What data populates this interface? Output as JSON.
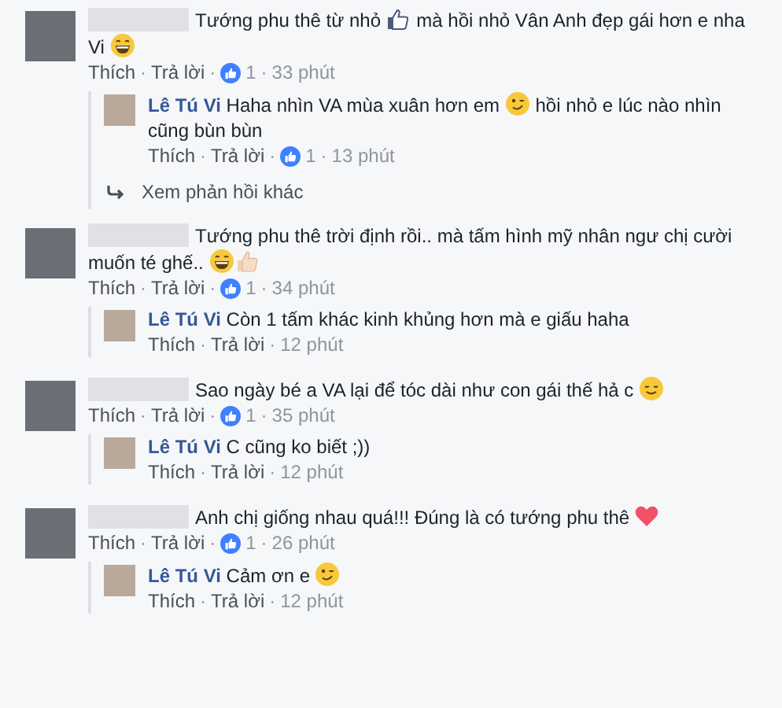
{
  "comments": [
    {
      "text": [
        {
          "kind": "text",
          "value": "Tướng phu thê từ nhỏ "
        },
        {
          "kind": "like-outline"
        },
        {
          "kind": "text",
          "value": " mà hồi nhỏ Vân Anh đẹp gái hơn e nha Vi "
        },
        {
          "kind": "laugh"
        }
      ],
      "meta": [
        {
          "kind": "link",
          "text": "Thích"
        },
        {
          "kind": "dot",
          "text": "·"
        },
        {
          "kind": "link",
          "text": "Trả lời"
        },
        {
          "kind": "dot",
          "text": "·"
        },
        {
          "kind": "likes",
          "text": "1"
        },
        {
          "kind": "dot",
          "text": "·"
        },
        {
          "kind": "time",
          "text": "33 phút"
        }
      ],
      "replies": [
        {
          "author": "Lê Tú Vi",
          "text": [
            {
              "kind": "text",
              "value": "Haha nhìn VA mùa xuân hơn em "
            },
            {
              "kind": "wink"
            },
            {
              "kind": "text",
              "value": " hồi nhỏ e lúc nào nhìn cũng bùn bùn"
            }
          ],
          "meta": [
            {
              "kind": "link",
              "text": "Thích"
            },
            {
              "kind": "dot",
              "text": "·"
            },
            {
              "kind": "link",
              "text": "Trả lời"
            },
            {
              "kind": "dot",
              "text": "·"
            },
            {
              "kind": "likes",
              "text": "1"
            },
            {
              "kind": "dot",
              "text": "·"
            },
            {
              "kind": "time",
              "text": "13 phút"
            }
          ]
        }
      ],
      "more_replies": "Xem phản hồi khác"
    },
    {
      "text": [
        {
          "kind": "text",
          "value": "Tướng phu thê trời định rồi.. mà tấm hình mỹ nhân ngư chị cười muốn té ghế.. "
        },
        {
          "kind": "laugh"
        },
        {
          "kind": "thumb"
        }
      ],
      "meta": [
        {
          "kind": "link",
          "text": "Thích"
        },
        {
          "kind": "dot",
          "text": "·"
        },
        {
          "kind": "link",
          "text": "Trả lời"
        },
        {
          "kind": "dot",
          "text": "·"
        },
        {
          "kind": "likes",
          "text": "1"
        },
        {
          "kind": "dot",
          "text": "·"
        },
        {
          "kind": "time",
          "text": "34 phút"
        }
      ],
      "replies": [
        {
          "author": "Lê Tú Vi",
          "text": [
            {
              "kind": "text",
              "value": "Còn 1 tấm khác kinh khủng hơn mà e giấu haha"
            }
          ],
          "meta": [
            {
              "kind": "link",
              "text": "Thích"
            },
            {
              "kind": "dot",
              "text": "·"
            },
            {
              "kind": "link",
              "text": "Trả lời"
            },
            {
              "kind": "dot",
              "text": "·"
            },
            {
              "kind": "time",
              "text": "12 phút"
            }
          ]
        }
      ]
    },
    {
      "text": [
        {
          "kind": "text",
          "value": "Sao ngày bé a VA lại để tóc dài như con gái thế hả c "
        },
        {
          "kind": "smile"
        }
      ],
      "meta": [
        {
          "kind": "link",
          "text": "Thích"
        },
        {
          "kind": "dot",
          "text": "·"
        },
        {
          "kind": "link",
          "text": "Trả lời"
        },
        {
          "kind": "dot",
          "text": "·"
        },
        {
          "kind": "likes",
          "text": "1"
        },
        {
          "kind": "dot",
          "text": "·"
        },
        {
          "kind": "time",
          "text": "35 phút"
        }
      ],
      "replies": [
        {
          "author": "Lê Tú Vi",
          "text": [
            {
              "kind": "text",
              "value": "C cũng ko biết ;))"
            }
          ],
          "meta": [
            {
              "kind": "link",
              "text": "Thích"
            },
            {
              "kind": "dot",
              "text": "·"
            },
            {
              "kind": "link",
              "text": "Trả lời"
            },
            {
              "kind": "dot",
              "text": "·"
            },
            {
              "kind": "time",
              "text": "12 phút"
            }
          ]
        }
      ]
    },
    {
      "text": [
        {
          "kind": "text",
          "value": "Anh chị giống nhau quá!!! Đúng là có tướng phu thê "
        },
        {
          "kind": "heart"
        }
      ],
      "meta": [
        {
          "kind": "link",
          "text": "Thích"
        },
        {
          "kind": "dot",
          "text": "·"
        },
        {
          "kind": "link",
          "text": "Trả lời"
        },
        {
          "kind": "dot",
          "text": "·"
        },
        {
          "kind": "likes",
          "text": "1"
        },
        {
          "kind": "dot",
          "text": "·"
        },
        {
          "kind": "time",
          "text": "26 phút"
        }
      ],
      "replies": [
        {
          "author": "Lê Tú Vi",
          "text": [
            {
              "kind": "text",
              "value": "Cảm ơn e "
            },
            {
              "kind": "wink"
            }
          ],
          "meta": [
            {
              "kind": "link",
              "text": "Thích"
            },
            {
              "kind": "dot",
              "text": "·"
            },
            {
              "kind": "link",
              "text": "Trả lời"
            },
            {
              "kind": "dot",
              "text": "·"
            },
            {
              "kind": "time",
              "text": "12 phút"
            }
          ]
        }
      ]
    }
  ]
}
